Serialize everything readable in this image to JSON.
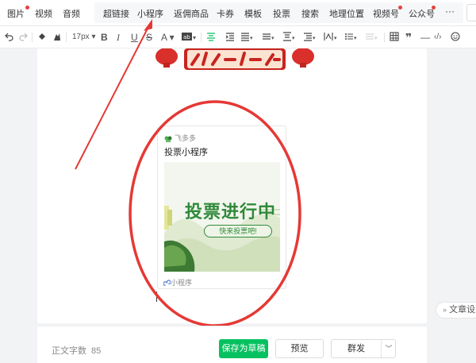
{
  "insert_toolbar": {
    "items": [
      {
        "label": "图片",
        "badge": true
      },
      {
        "label": "视频",
        "badge": false
      },
      {
        "label": "音频",
        "badge": false
      },
      {
        "label": "超链接",
        "badge": false
      },
      {
        "label": "小程序",
        "badge": false
      },
      {
        "label": "返佣商品",
        "badge": false
      },
      {
        "label": "卡券",
        "badge": false
      },
      {
        "label": "模板",
        "badge": false
      },
      {
        "label": "投票",
        "badge": false
      },
      {
        "label": "搜索",
        "badge": false
      },
      {
        "label": "地理位置",
        "badge": false
      },
      {
        "label": "视频号",
        "badge": true
      },
      {
        "label": "公众号",
        "badge": true
      }
    ],
    "more_label": "···"
  },
  "format_toolbar": {
    "font_size": "17px",
    "icons": [
      "undo-icon",
      "redo-icon",
      "format-painter-icon",
      "clear-format-icon",
      "bold-icon",
      "italic-icon",
      "underline-icon",
      "strikethrough-icon",
      "font-color-icon",
      "background-color-icon",
      "align-center-icon",
      "indent-icon",
      "align-justify-icon",
      "line-height-icon",
      "paragraph-spacing-icon",
      "letter-spacing-icon",
      "list-icon",
      "table-icon",
      "quote-icon",
      "divider-icon",
      "code-icon",
      "emoji-icon"
    ]
  },
  "miniprogram_card": {
    "source_name": "飞多多",
    "title": "投票小程序",
    "image_headline": "投票进行中",
    "image_button": "快来投票吧!",
    "footer_label": "小程序"
  },
  "side_panel": {
    "label": "文章设置"
  },
  "bottom_bar": {
    "word_count_label": "正文字数",
    "word_count": "85",
    "save_draft": "保存为草稿",
    "preview": "预览",
    "publish": "群发"
  },
  "colors": {
    "accent": "#07c160",
    "annotation": "#e53935",
    "badge": "#e64340"
  }
}
